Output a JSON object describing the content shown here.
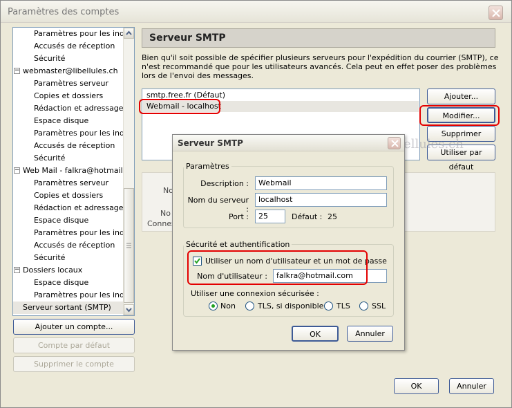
{
  "window": {
    "title": "Paramètres des comptes"
  },
  "tree": [
    {
      "label": "Paramètres pour les ind...",
      "level": "child"
    },
    {
      "label": "Accusés de réception",
      "level": "child"
    },
    {
      "label": "Sécurité",
      "level": "child"
    },
    {
      "label": "webmaster@libellules.ch",
      "level": "parent"
    },
    {
      "label": "Paramètres serveur",
      "level": "child"
    },
    {
      "label": "Copies et dossiers",
      "level": "child"
    },
    {
      "label": "Rédaction et adressage",
      "level": "child"
    },
    {
      "label": "Espace disque",
      "level": "child"
    },
    {
      "label": "Paramètres pour les ind...",
      "level": "child"
    },
    {
      "label": "Accusés de réception",
      "level": "child"
    },
    {
      "label": "Sécurité",
      "level": "child"
    },
    {
      "label": "Web Mail - falkra@hotmail...",
      "level": "parent"
    },
    {
      "label": "Paramètres serveur",
      "level": "child"
    },
    {
      "label": "Copies et dossiers",
      "level": "child"
    },
    {
      "label": "Rédaction et adressage",
      "level": "child"
    },
    {
      "label": "Espace disque",
      "level": "child"
    },
    {
      "label": "Paramètres pour les ind...",
      "level": "child"
    },
    {
      "label": "Accusés de réception",
      "level": "child"
    },
    {
      "label": "Sécurité",
      "level": "child"
    },
    {
      "label": "Dossiers locaux",
      "level": "parent"
    },
    {
      "label": "Espace disque",
      "level": "child"
    },
    {
      "label": "Paramètres pour les ind...",
      "level": "child"
    },
    {
      "label": "Serveur sortant (SMTP)",
      "level": "root",
      "selected": true
    }
  ],
  "left_buttons": {
    "add_account": "Ajouter un compte...",
    "default_account": "Compte par défaut",
    "delete_account": "Supprimer le compte"
  },
  "panel": {
    "header": "Serveur SMTP",
    "description": "Bien qu'il soit possible de spécifier plusieurs serveurs pour l'expédition du courrier (SMTP), ce n'est recommandé que pour les utilisateurs avancés. Cela peut en effet poser des problèmes lors de l'envoi des messages.",
    "servers": [
      "smtp.free.fr (Défaut)",
      "Webmail - localhost"
    ],
    "buttons": {
      "add": "Ajouter...",
      "edit": "Modifier...",
      "delete": "Supprimer",
      "default": "Utiliser par défaut"
    },
    "detail_labels": [
      "No",
      "No",
      "Connex"
    ]
  },
  "watermark": "libellules.ch",
  "dialog": {
    "title": "Serveur SMTP",
    "params_legend": "Paramètres",
    "description_label": "Description :",
    "description_value": "Webmail",
    "server_label": "Nom du serveur :",
    "server_value": "localhost",
    "port_label": "Port :",
    "port_value": "25",
    "default_label": "Défaut :",
    "default_value": "25",
    "security_legend": "Sécurité et authentification",
    "use_auth_label": "Utiliser un nom d'utilisateur et un mot de passe",
    "use_auth_checked": true,
    "username_label": "Nom d'utilisateur :",
    "username_value": "falkra@hotmail.com",
    "secure_conn_label": "Utiliser une connexion sécurisée :",
    "radios": [
      {
        "label": "Non",
        "selected": true
      },
      {
        "label": "TLS, si disponible",
        "selected": false
      },
      {
        "label": "TLS",
        "selected": false
      },
      {
        "label": "SSL",
        "selected": false
      }
    ],
    "ok": "OK",
    "cancel": "Annuler"
  },
  "footer": {
    "ok": "OK",
    "cancel": "Annuler"
  },
  "colors": {
    "highlight": "#e30000",
    "accent_border": "#3d5a96"
  }
}
